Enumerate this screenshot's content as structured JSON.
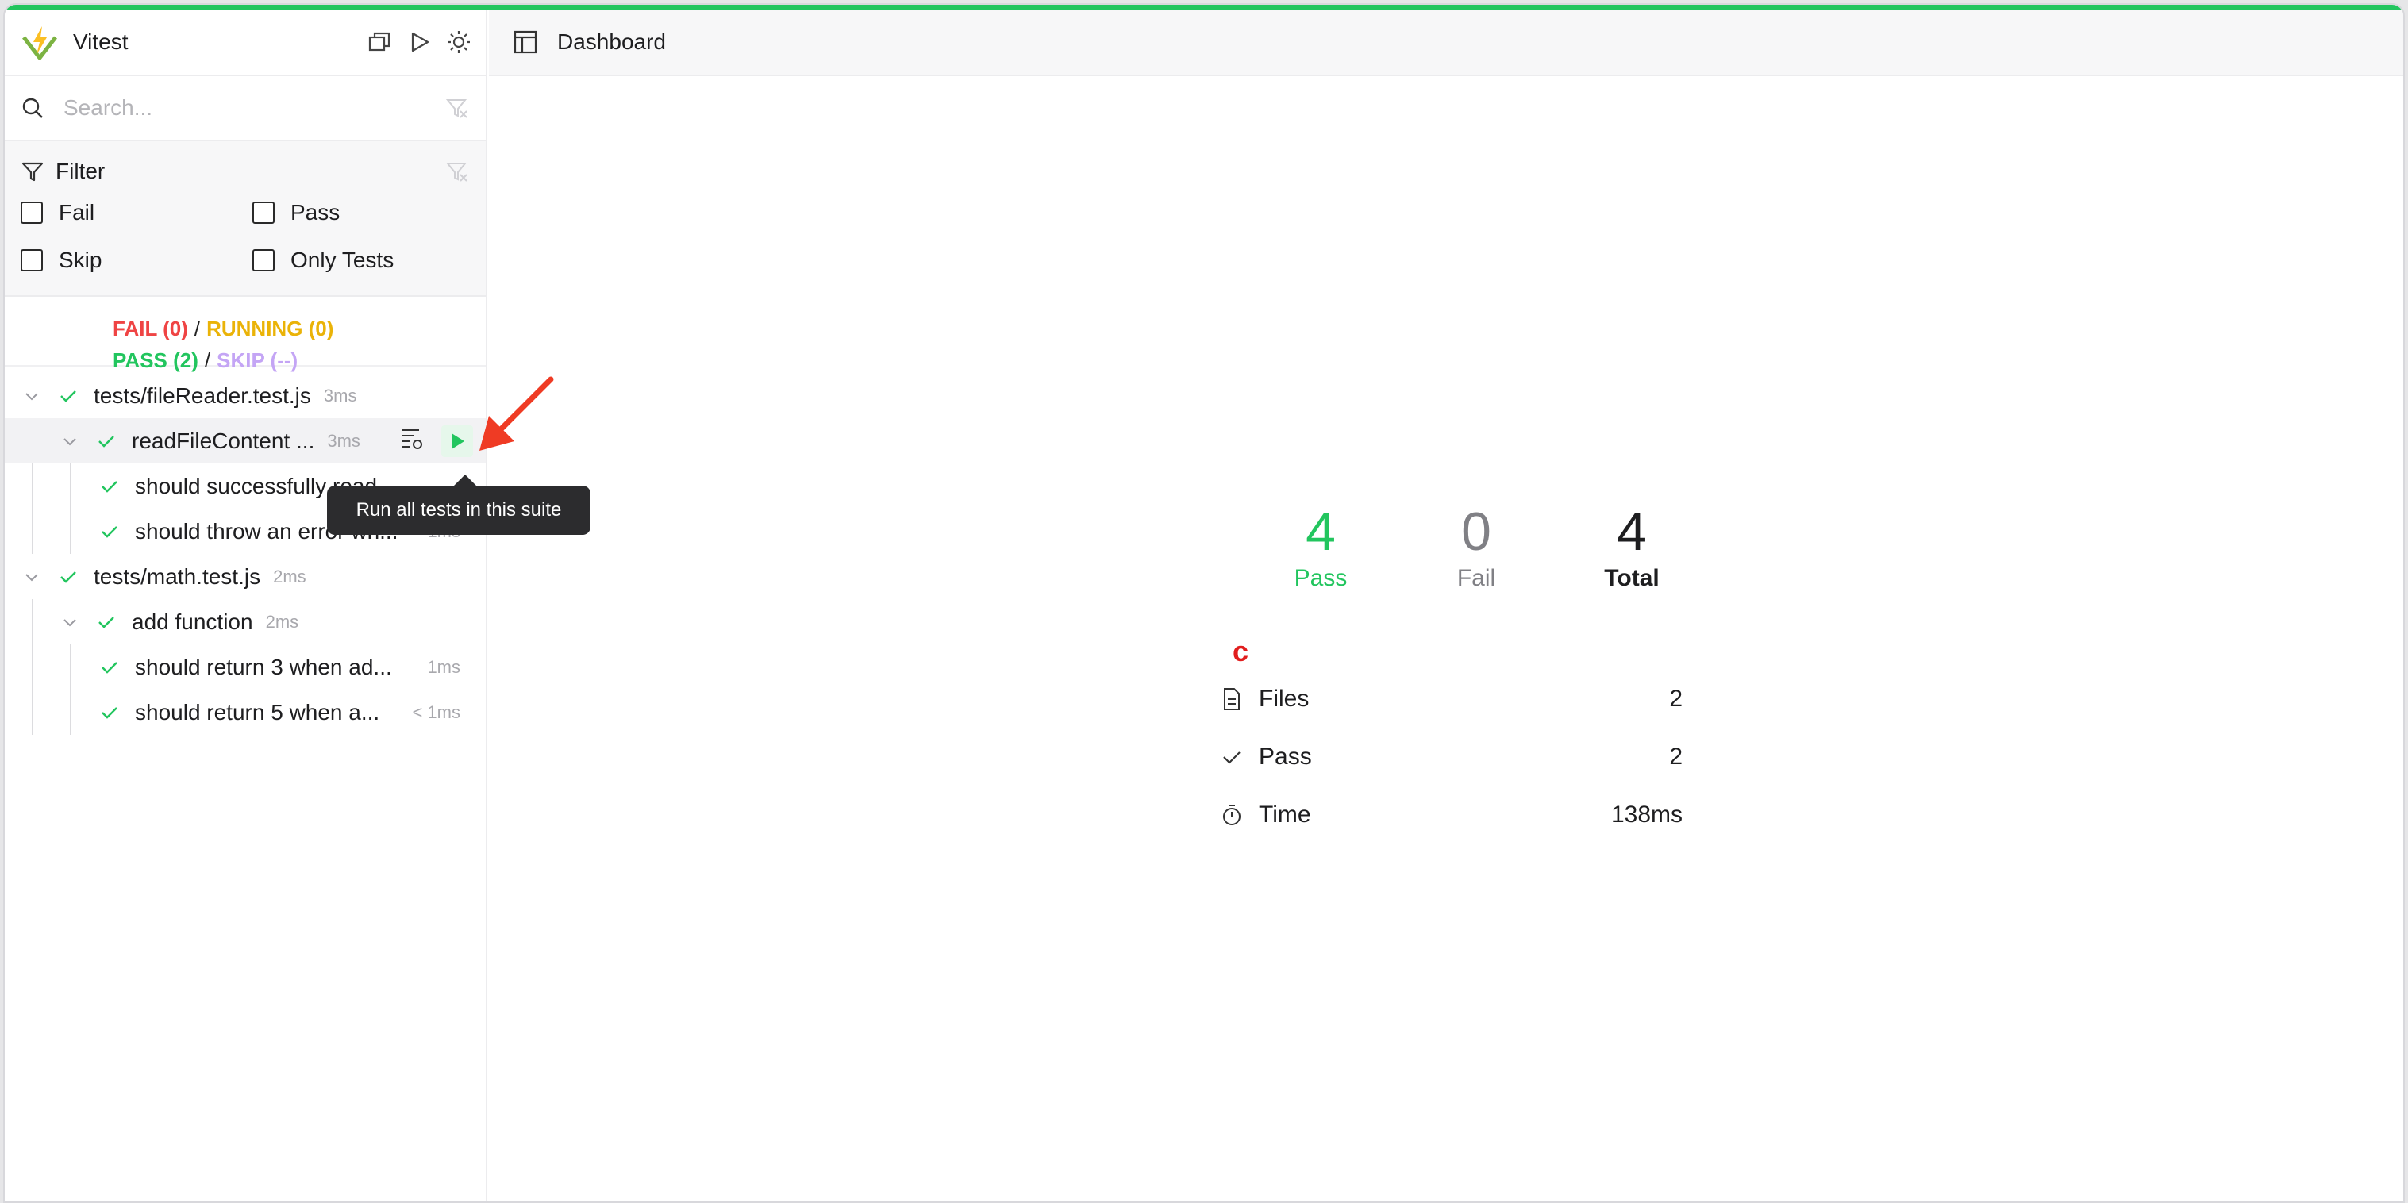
{
  "app": {
    "title": "Vitest"
  },
  "search": {
    "placeholder": "Search..."
  },
  "filter": {
    "title": "Filter",
    "options": [
      "Fail",
      "Pass",
      "Skip",
      "Only Tests"
    ]
  },
  "summary": {
    "fail": "FAIL (0)",
    "running": "RUNNING (0)",
    "pass": "PASS (2)",
    "skip": "SKIP (--)",
    "sep": "/"
  },
  "tree": [
    {
      "label": "tests/fileReader.test.js",
      "duration": "3ms"
    },
    {
      "label": "readFileContent ...",
      "duration": "3ms"
    },
    {
      "label": "should successfully read",
      "duration": ""
    },
    {
      "label": "should throw an error wh...",
      "duration": "1ms"
    },
    {
      "label": "tests/math.test.js",
      "duration": "2ms"
    },
    {
      "label": "add function",
      "duration": "2ms"
    },
    {
      "label": "should return 3 when ad...",
      "duration": "1ms"
    },
    {
      "label": "should return 5 when a...",
      "duration": "< 1ms"
    }
  ],
  "tooltip": "Run all tests in this suite",
  "main": {
    "title": "Dashboard"
  },
  "stats": {
    "pass": {
      "value": "4",
      "label": "Pass"
    },
    "fail": {
      "value": "0",
      "label": "Fail"
    },
    "total": {
      "value": "4",
      "label": "Total"
    }
  },
  "info": [
    {
      "label": "Files",
      "value": "2",
      "icon": "file-icon"
    },
    {
      "label": "Pass",
      "value": "2",
      "icon": "check-icon"
    },
    {
      "label": "Time",
      "value": "138ms",
      "icon": "timer-icon"
    }
  ],
  "cursor_mark": "c",
  "colors": {
    "accent": "#22c55e",
    "fail": "#ef4444",
    "running": "#eab308",
    "skip": "#c4a5f5"
  }
}
